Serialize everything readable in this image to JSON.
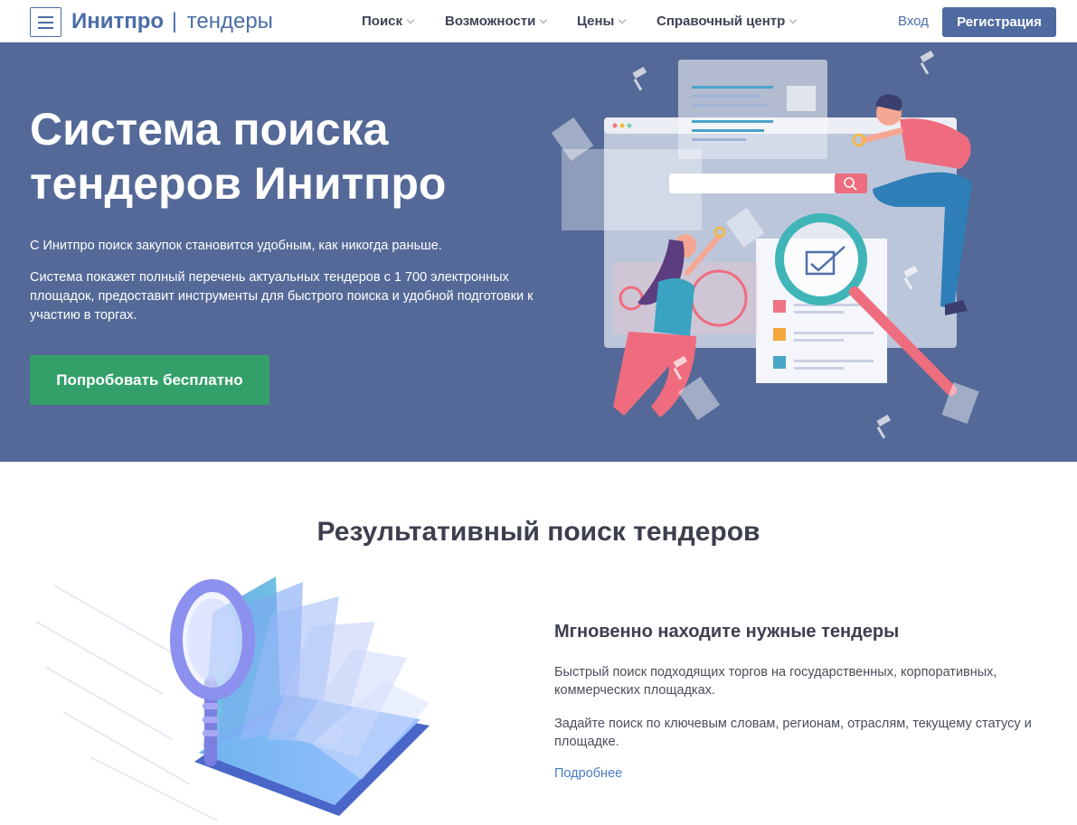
{
  "header": {
    "logo_brand": "Инитпро",
    "logo_separator": "|",
    "logo_sub": "тендеры",
    "nav": [
      {
        "label": "Поиск"
      },
      {
        "label": "Возможности"
      },
      {
        "label": "Цены"
      },
      {
        "label": "Справочный центр"
      }
    ],
    "login_label": "Вход",
    "register_label": "Регистрация"
  },
  "hero": {
    "title_line1": "Система поиска",
    "title_line2": "тендеров Инитпро",
    "lead": "С Инитпро поиск закупок становится удобным, как никогда раньше.",
    "description": "Система покажет полный перечень актуальных тендеров с 1 700 электронных площадок, предоставит инструменты для быстрого поиска и удобной подготовки к участию в торгах.",
    "cta_label": "Попробовать бесплатно"
  },
  "section": {
    "title": "Результативный поиск тендеров",
    "feature_title": "Мгновенно находите нужные тендеры",
    "feature_p1": "Быстрый поиск подходящих торгов на государственных, корпоративных, коммерческих площадках.",
    "feature_p2": "Задайте поиск по ключевым словам, регионам, отраслям, текущему статусу и площадке.",
    "more_link": "Подробнее"
  },
  "colors": {
    "brand": "#4a6da7",
    "hero_bg": "#546997",
    "cta": "#33a06a",
    "register_bg": "#4e6aa0",
    "link": "#4a7cc4"
  },
  "icons": [
    "menu-icon",
    "chevron-down-icon",
    "search-icon",
    "magnifier-icon",
    "gavel-icon",
    "document-icon",
    "checkbox-icon",
    "book-icon"
  ]
}
